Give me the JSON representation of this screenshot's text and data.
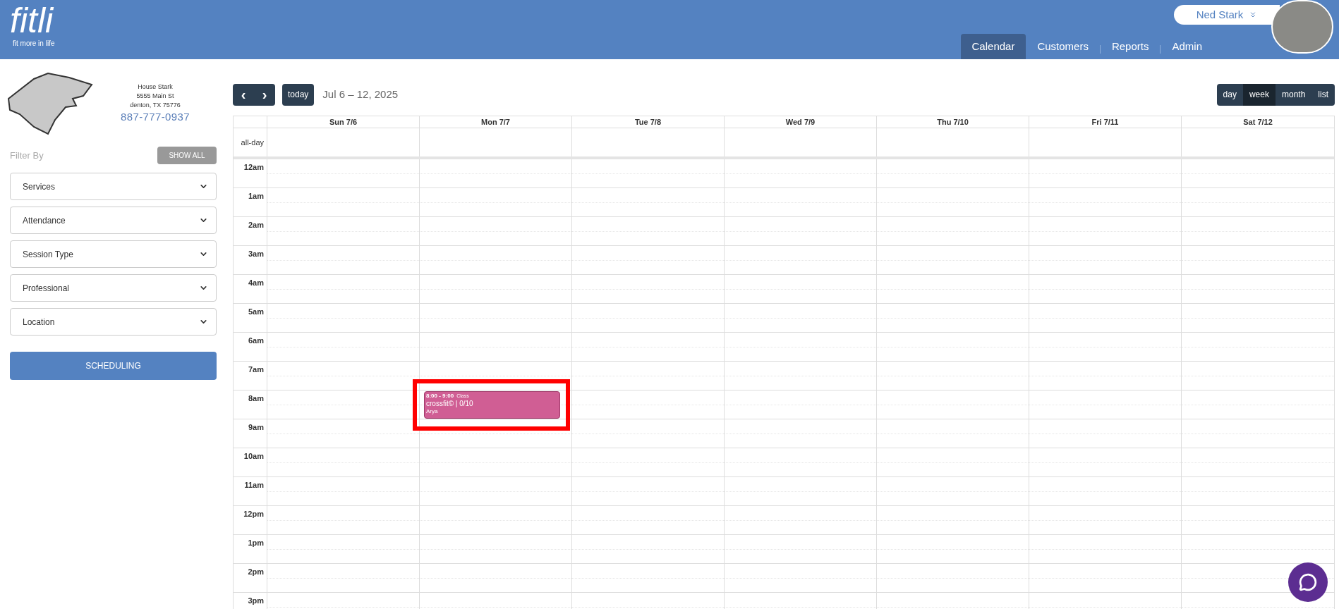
{
  "header": {
    "logo": "fitli",
    "tagline": "fit more in life",
    "user": {
      "name": "Ned Stark"
    },
    "nav": [
      {
        "label": "Calendar",
        "selected": true
      },
      {
        "label": "Customers",
        "selected": false
      },
      {
        "label": "Reports",
        "selected": false
      },
      {
        "label": "Admin",
        "selected": false
      }
    ]
  },
  "business": {
    "name": "House Stark",
    "address": "5555 Main St",
    "city": "denton, TX 75776",
    "phone": "887-777-0937"
  },
  "filter": {
    "label": "Filter By",
    "show_all": "SHOW ALL",
    "selects": [
      "Services",
      "Attendance",
      "Session Type",
      "Professional",
      "Location"
    ],
    "scheduling": "SCHEDULING"
  },
  "toolbar": {
    "prev": "‹",
    "next": "›",
    "today": "today",
    "range": "Jul 6 – 12, 2025",
    "views": [
      {
        "label": "day",
        "selected": false
      },
      {
        "label": "week",
        "selected": true
      },
      {
        "label": "month",
        "selected": false
      },
      {
        "label": "list",
        "selected": false
      }
    ]
  },
  "calendar": {
    "all_day": "all-day",
    "days": [
      {
        "label": "Sun 7/6"
      },
      {
        "label": "Mon 7/7",
        "events": [
          {
            "time": "8:00 - 9:00",
            "type": "Class",
            "title": "crossfit© | 0/10",
            "person": "Arya",
            "color": "#d05e94",
            "highlighted": true
          }
        ]
      },
      {
        "label": "Tue 7/8"
      },
      {
        "label": "Wed 7/9"
      },
      {
        "label": "Thu 7/10"
      },
      {
        "label": "Fri 7/11"
      },
      {
        "label": "Sat 7/12"
      }
    ],
    "hours": [
      "12am",
      "1am",
      "2am",
      "3am",
      "4am",
      "5am",
      "6am",
      "7am",
      "8am",
      "9am",
      "10am",
      "11am",
      "12pm",
      "1pm",
      "2pm",
      "3pm"
    ]
  }
}
